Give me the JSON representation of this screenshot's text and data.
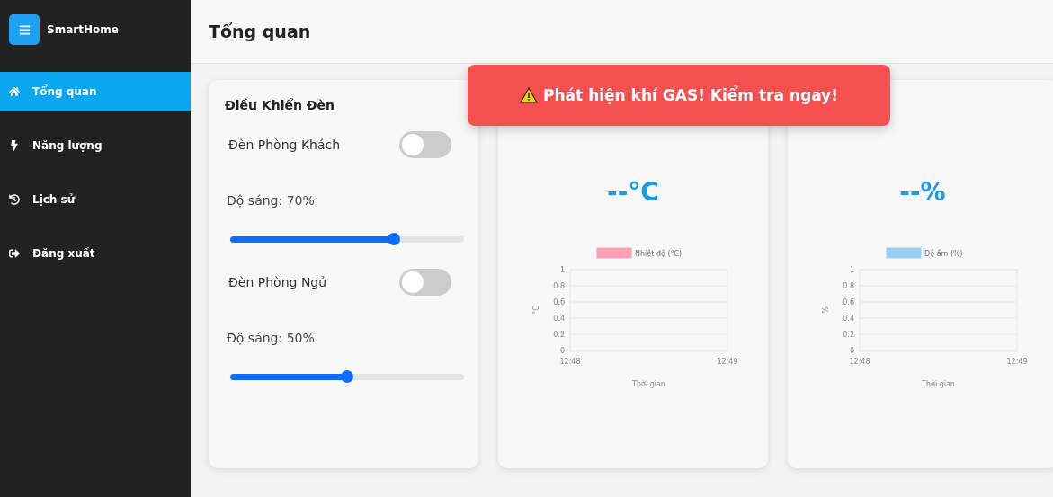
{
  "sidebar": {
    "brand": "SmartHome",
    "items": [
      {
        "label": "Tổng quan",
        "selected": true
      },
      {
        "label": "Năng lượng",
        "selected": false
      },
      {
        "label": "Lịch sử",
        "selected": false
      },
      {
        "label": "Đăng xuất",
        "selected": false
      }
    ]
  },
  "page_title": "Tổng quan",
  "alert": {
    "text": "Phát hiện khí GAS! Kiểm tra ngay!"
  },
  "light_control": {
    "title": "Điều Khiển Đèn",
    "lights": [
      {
        "name": "Đèn Phòng Khách",
        "on": false,
        "brightness_label": "Độ sáng: 70%",
        "level": 0.7
      },
      {
        "name": "Đèn Phòng Ngủ",
        "on": false,
        "brightness_label": "Độ sáng: 50%",
        "level": 0.5
      }
    ]
  },
  "sensors": [
    {
      "value": "--°C",
      "chart_data": {
        "type": "line",
        "xlabel": "Thời gian",
        "ylabel": "°C",
        "categories": [
          "12:48",
          "12:49"
        ],
        "series": [
          {
            "name": "Nhiệt độ (°C)",
            "color": "#ff9fb3",
            "values": [
              null,
              null
            ]
          }
        ],
        "ylim": [
          0,
          1
        ],
        "yticks": [
          0,
          0.2,
          0.4,
          0.6,
          0.8,
          1
        ]
      }
    },
    {
      "value": "--%",
      "chart_data": {
        "type": "line",
        "xlabel": "Thời gian",
        "ylabel": "%",
        "categories": [
          "12:48",
          "12:49"
        ],
        "series": [
          {
            "name": "Độ ẩm (%)",
            "color": "#9ccff3",
            "values": [
              null,
              null
            ]
          }
        ],
        "ylim": [
          0,
          1
        ],
        "yticks": [
          0,
          0.2,
          0.4,
          0.6,
          0.8,
          1
        ]
      }
    }
  ]
}
